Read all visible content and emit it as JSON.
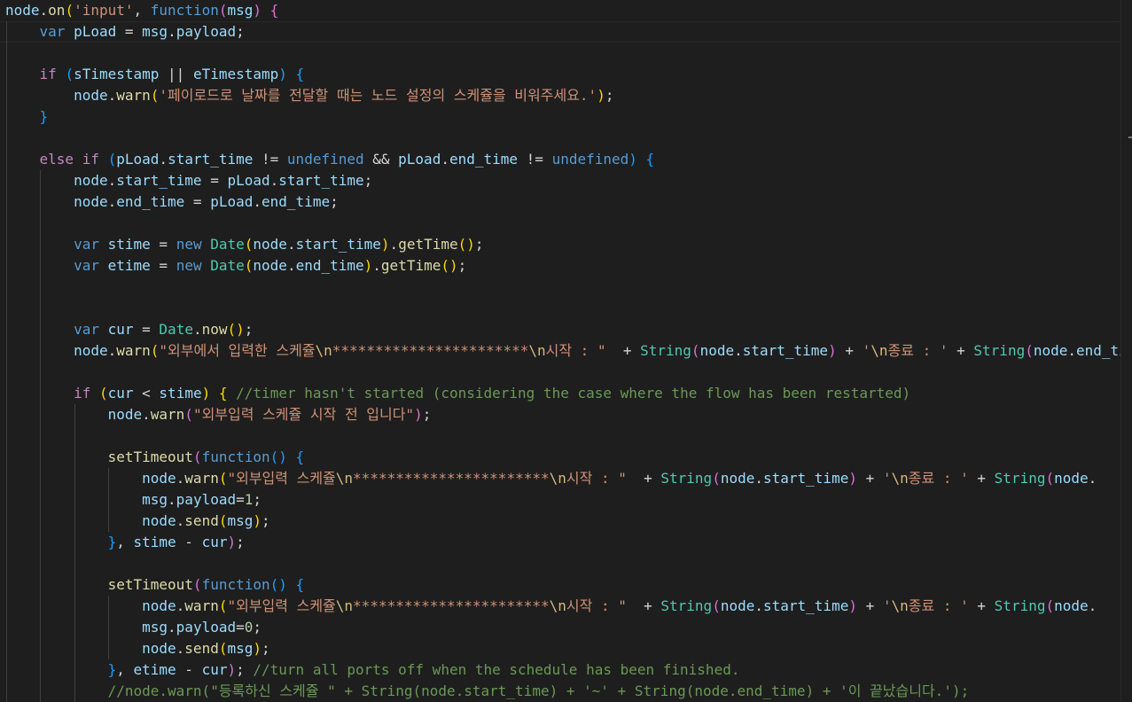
{
  "editor": {
    "language": "javascript",
    "theme": "dark",
    "colors": {
      "background": "#1e1e1e",
      "keyword": "#569cd6",
      "control": "#c586c0",
      "function": "#dcdcaa",
      "variable": "#9cdcfe",
      "string": "#ce9178",
      "escape": "#d7ba7d",
      "type": "#4ec9b0",
      "comment": "#6a9955",
      "number": "#b5cea8"
    },
    "lines": [
      [
        [
          "v",
          "node"
        ],
        [
          "p",
          "."
        ],
        [
          "fn",
          "on"
        ],
        [
          "b1",
          "("
        ],
        [
          "s",
          "'input'"
        ],
        [
          "p",
          ", "
        ],
        [
          "k",
          "function"
        ],
        [
          "b2",
          "("
        ],
        [
          "v",
          "msg"
        ],
        [
          "b2",
          ")"
        ],
        [
          "p",
          " "
        ],
        [
          "b2",
          "{"
        ]
      ],
      [
        [
          "p",
          "    "
        ],
        [
          "k",
          "var"
        ],
        [
          "p",
          " "
        ],
        [
          "v",
          "pLoad"
        ],
        [
          "p",
          " = "
        ],
        [
          "v",
          "msg"
        ],
        [
          "p",
          "."
        ],
        [
          "v",
          "payload"
        ],
        [
          "p",
          ";"
        ]
      ],
      [],
      [
        [
          "p",
          "    "
        ],
        [
          "kc",
          "if"
        ],
        [
          "p",
          " "
        ],
        [
          "b3",
          "("
        ],
        [
          "v",
          "sTimestamp"
        ],
        [
          "p",
          " || "
        ],
        [
          "v",
          "eTimestamp"
        ],
        [
          "b3",
          ")"
        ],
        [
          "p",
          " "
        ],
        [
          "b3",
          "{"
        ]
      ],
      [
        [
          "p",
          "        "
        ],
        [
          "v",
          "node"
        ],
        [
          "p",
          "."
        ],
        [
          "fn",
          "warn"
        ],
        [
          "b1",
          "("
        ],
        [
          "s",
          "'페이로드로 날짜를 전달할 때는 노드 설정의 스케쥴을 비워주세요.'"
        ],
        [
          "b1",
          ")"
        ],
        [
          "p",
          ";"
        ]
      ],
      [
        [
          "p",
          "    "
        ],
        [
          "b3",
          "}"
        ]
      ],
      [],
      [
        [
          "p",
          "    "
        ],
        [
          "kc",
          "else"
        ],
        [
          "p",
          " "
        ],
        [
          "kc",
          "if"
        ],
        [
          "p",
          " "
        ],
        [
          "b3",
          "("
        ],
        [
          "v",
          "pLoad"
        ],
        [
          "p",
          "."
        ],
        [
          "v",
          "start_time"
        ],
        [
          "p",
          " != "
        ],
        [
          "k",
          "undefined"
        ],
        [
          "p",
          " && "
        ],
        [
          "v",
          "pLoad"
        ],
        [
          "p",
          "."
        ],
        [
          "v",
          "end_time"
        ],
        [
          "p",
          " != "
        ],
        [
          "k",
          "undefined"
        ],
        [
          "b3",
          ")"
        ],
        [
          "p",
          " "
        ],
        [
          "b3",
          "{"
        ]
      ],
      [
        [
          "p",
          "        "
        ],
        [
          "v",
          "node"
        ],
        [
          "p",
          "."
        ],
        [
          "v",
          "start_time"
        ],
        [
          "p",
          " = "
        ],
        [
          "v",
          "pLoad"
        ],
        [
          "p",
          "."
        ],
        [
          "v",
          "start_time"
        ],
        [
          "p",
          ";"
        ]
      ],
      [
        [
          "p",
          "        "
        ],
        [
          "v",
          "node"
        ],
        [
          "p",
          "."
        ],
        [
          "v",
          "end_time"
        ],
        [
          "p",
          " = "
        ],
        [
          "v",
          "pLoad"
        ],
        [
          "p",
          "."
        ],
        [
          "v",
          "end_time"
        ],
        [
          "p",
          ";"
        ]
      ],
      [],
      [
        [
          "p",
          "        "
        ],
        [
          "k",
          "var"
        ],
        [
          "p",
          " "
        ],
        [
          "v",
          "stime"
        ],
        [
          "p",
          " = "
        ],
        [
          "k",
          "new"
        ],
        [
          "p",
          " "
        ],
        [
          "t",
          "Date"
        ],
        [
          "b1",
          "("
        ],
        [
          "v",
          "node"
        ],
        [
          "p",
          "."
        ],
        [
          "v",
          "start_time"
        ],
        [
          "b1",
          ")"
        ],
        [
          "p",
          "."
        ],
        [
          "fn",
          "getTime"
        ],
        [
          "b1",
          "()"
        ],
        [
          "p",
          ";"
        ]
      ],
      [
        [
          "p",
          "        "
        ],
        [
          "k",
          "var"
        ],
        [
          "p",
          " "
        ],
        [
          "v",
          "etime"
        ],
        [
          "p",
          " = "
        ],
        [
          "k",
          "new"
        ],
        [
          "p",
          " "
        ],
        [
          "t",
          "Date"
        ],
        [
          "b1",
          "("
        ],
        [
          "v",
          "node"
        ],
        [
          "p",
          "."
        ],
        [
          "v",
          "end_time"
        ],
        [
          "b1",
          ")"
        ],
        [
          "p",
          "."
        ],
        [
          "fn",
          "getTime"
        ],
        [
          "b1",
          "()"
        ],
        [
          "p",
          ";"
        ]
      ],
      [],
      [],
      [
        [
          "p",
          "        "
        ],
        [
          "k",
          "var"
        ],
        [
          "p",
          " "
        ],
        [
          "v",
          "cur"
        ],
        [
          "p",
          " = "
        ],
        [
          "t",
          "Date"
        ],
        [
          "p",
          "."
        ],
        [
          "fn",
          "now"
        ],
        [
          "b1",
          "()"
        ],
        [
          "p",
          ";"
        ]
      ],
      [
        [
          "p",
          "        "
        ],
        [
          "v",
          "node"
        ],
        [
          "p",
          "."
        ],
        [
          "fn",
          "warn"
        ],
        [
          "b1",
          "("
        ],
        [
          "s",
          "\"외부에서 입력한 스케쥴"
        ],
        [
          "e",
          "\\n"
        ],
        [
          "s",
          "***********************"
        ],
        [
          "e",
          "\\n"
        ],
        [
          "s",
          "시작 : \""
        ],
        [
          "p",
          "  + "
        ],
        [
          "t",
          "String"
        ],
        [
          "b2",
          "("
        ],
        [
          "v",
          "node"
        ],
        [
          "p",
          "."
        ],
        [
          "v",
          "start_time"
        ],
        [
          "b2",
          ")"
        ],
        [
          "p",
          " + "
        ],
        [
          "s",
          "'"
        ],
        [
          "e",
          "\\n"
        ],
        [
          "s",
          "종료 : '"
        ],
        [
          "p",
          " + "
        ],
        [
          "t",
          "String"
        ],
        [
          "b2",
          "("
        ],
        [
          "v",
          "node"
        ],
        [
          "p",
          "."
        ],
        [
          "v",
          "end_time"
        ],
        [
          "b2",
          ")"
        ]
      ],
      [],
      [
        [
          "p",
          "        "
        ],
        [
          "kc",
          "if"
        ],
        [
          "p",
          " "
        ],
        [
          "b1",
          "("
        ],
        [
          "v",
          "cur"
        ],
        [
          "p",
          " < "
        ],
        [
          "v",
          "stime"
        ],
        [
          "b1",
          ")"
        ],
        [
          "p",
          " "
        ],
        [
          "b1",
          "{"
        ],
        [
          "p",
          " "
        ],
        [
          "c",
          "//timer hasn't started (considering the case where the flow has been restarted)"
        ]
      ],
      [
        [
          "p",
          "            "
        ],
        [
          "v",
          "node"
        ],
        [
          "p",
          "."
        ],
        [
          "fn",
          "warn"
        ],
        [
          "b2",
          "("
        ],
        [
          "s",
          "\"외부입력 스케쥴 시작 전 입니다\""
        ],
        [
          "b2",
          ")"
        ],
        [
          "p",
          ";"
        ]
      ],
      [],
      [
        [
          "p",
          "            "
        ],
        [
          "fn",
          "setTimeout"
        ],
        [
          "b2",
          "("
        ],
        [
          "k",
          "function"
        ],
        [
          "b3",
          "()"
        ],
        [
          "p",
          " "
        ],
        [
          "b3",
          "{"
        ]
      ],
      [
        [
          "p",
          "                "
        ],
        [
          "v",
          "node"
        ],
        [
          "p",
          "."
        ],
        [
          "fn",
          "warn"
        ],
        [
          "b1",
          "("
        ],
        [
          "s",
          "\"외부입력 스케쥴"
        ],
        [
          "e",
          "\\n"
        ],
        [
          "s",
          "***********************"
        ],
        [
          "e",
          "\\n"
        ],
        [
          "s",
          "시작 : \""
        ],
        [
          "p",
          "  + "
        ],
        [
          "t",
          "String"
        ],
        [
          "b2",
          "("
        ],
        [
          "v",
          "node"
        ],
        [
          "p",
          "."
        ],
        [
          "v",
          "start_time"
        ],
        [
          "b2",
          ")"
        ],
        [
          "p",
          " + "
        ],
        [
          "s",
          "'"
        ],
        [
          "e",
          "\\n"
        ],
        [
          "s",
          "종료 : '"
        ],
        [
          "p",
          " + "
        ],
        [
          "t",
          "String"
        ],
        [
          "b2",
          "("
        ],
        [
          "v",
          "node"
        ],
        [
          "p",
          "."
        ]
      ],
      [
        [
          "p",
          "                "
        ],
        [
          "v",
          "msg"
        ],
        [
          "p",
          "."
        ],
        [
          "v",
          "payload"
        ],
        [
          "p",
          "="
        ],
        [
          "n",
          "1"
        ],
        [
          "p",
          ";"
        ]
      ],
      [
        [
          "p",
          "                "
        ],
        [
          "v",
          "node"
        ],
        [
          "p",
          "."
        ],
        [
          "fn",
          "send"
        ],
        [
          "b1",
          "("
        ],
        [
          "v",
          "msg"
        ],
        [
          "b1",
          ")"
        ],
        [
          "p",
          ";"
        ]
      ],
      [
        [
          "p",
          "            "
        ],
        [
          "b3",
          "}"
        ],
        [
          "p",
          ", "
        ],
        [
          "v",
          "stime"
        ],
        [
          "p",
          " - "
        ],
        [
          "v",
          "cur"
        ],
        [
          "b2",
          ")"
        ],
        [
          "p",
          ";"
        ]
      ],
      [],
      [
        [
          "p",
          "            "
        ],
        [
          "fn",
          "setTimeout"
        ],
        [
          "b2",
          "("
        ],
        [
          "k",
          "function"
        ],
        [
          "b3",
          "()"
        ],
        [
          "p",
          " "
        ],
        [
          "b3",
          "{"
        ]
      ],
      [
        [
          "p",
          "                "
        ],
        [
          "v",
          "node"
        ],
        [
          "p",
          "."
        ],
        [
          "fn",
          "warn"
        ],
        [
          "b1",
          "("
        ],
        [
          "s",
          "\"외부입력 스케쥴"
        ],
        [
          "e",
          "\\n"
        ],
        [
          "s",
          "***********************"
        ],
        [
          "e",
          "\\n"
        ],
        [
          "s",
          "시작 : \""
        ],
        [
          "p",
          "  + "
        ],
        [
          "t",
          "String"
        ],
        [
          "b2",
          "("
        ],
        [
          "v",
          "node"
        ],
        [
          "p",
          "."
        ],
        [
          "v",
          "start_time"
        ],
        [
          "b2",
          ")"
        ],
        [
          "p",
          " + "
        ],
        [
          "s",
          "'"
        ],
        [
          "e",
          "\\n"
        ],
        [
          "s",
          "종료 : '"
        ],
        [
          "p",
          " + "
        ],
        [
          "t",
          "String"
        ],
        [
          "b2",
          "("
        ],
        [
          "v",
          "node"
        ],
        [
          "p",
          "."
        ]
      ],
      [
        [
          "p",
          "                "
        ],
        [
          "v",
          "msg"
        ],
        [
          "p",
          "."
        ],
        [
          "v",
          "payload"
        ],
        [
          "p",
          "="
        ],
        [
          "n",
          "0"
        ],
        [
          "p",
          ";"
        ]
      ],
      [
        [
          "p",
          "                "
        ],
        [
          "v",
          "node"
        ],
        [
          "p",
          "."
        ],
        [
          "fn",
          "send"
        ],
        [
          "b1",
          "("
        ],
        [
          "v",
          "msg"
        ],
        [
          "b1",
          ")"
        ],
        [
          "p",
          ";"
        ]
      ],
      [
        [
          "p",
          "            "
        ],
        [
          "b3",
          "}"
        ],
        [
          "p",
          ", "
        ],
        [
          "v",
          "etime"
        ],
        [
          "p",
          " - "
        ],
        [
          "v",
          "cur"
        ],
        [
          "b2",
          ")"
        ],
        [
          "p",
          "; "
        ],
        [
          "c",
          "//turn all ports off when the schedule has been finished."
        ]
      ],
      [
        [
          "p",
          "            "
        ],
        [
          "c",
          "//node.warn(\"등록하신 스케쥴 \" + String(node.start_time) + '~' + String(node.end_time) + '이 끝났습니다.');"
        ]
      ]
    ]
  }
}
